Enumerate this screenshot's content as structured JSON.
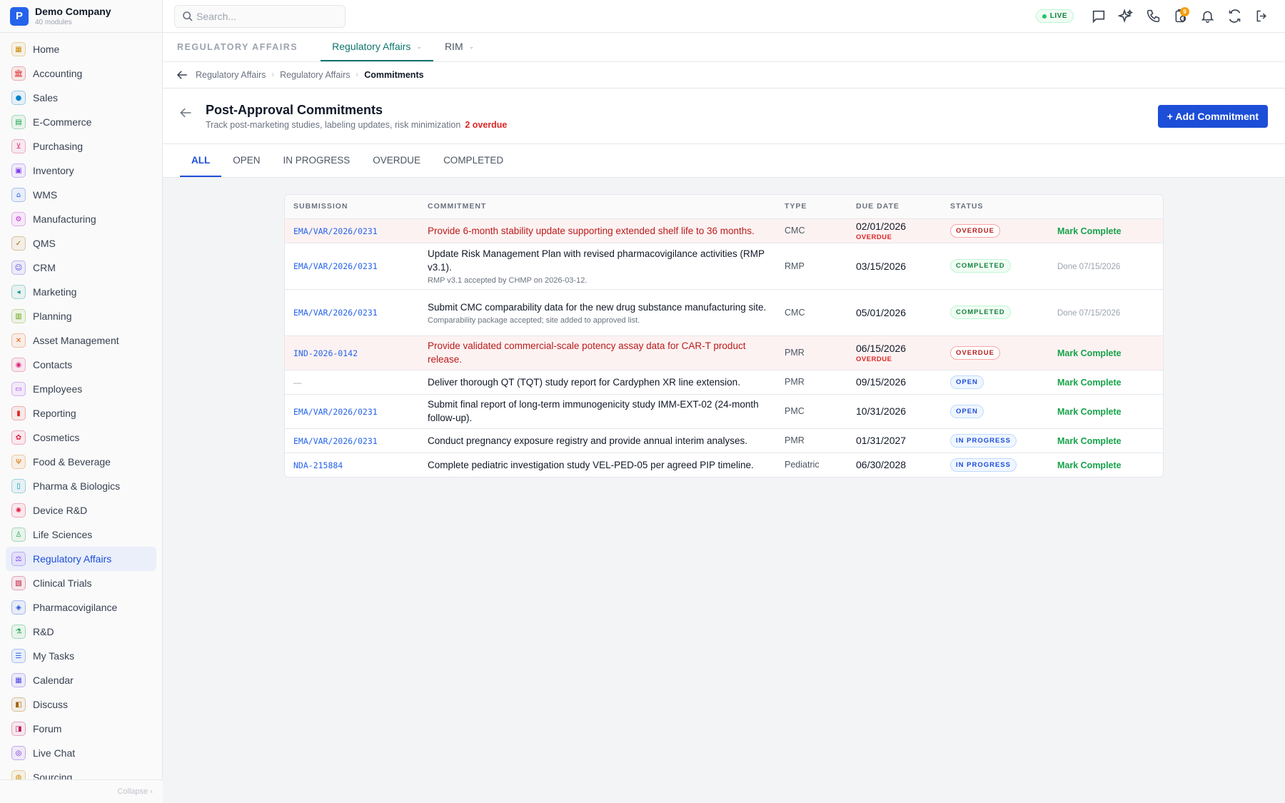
{
  "brand": {
    "logo_letter": "P",
    "name": "Demo Company",
    "sub": "40 modules"
  },
  "sidebar": {
    "items": [
      {
        "label": "Home",
        "icon": "grid-icon",
        "glyph": "▦",
        "color": "#ca8a04"
      },
      {
        "label": "Accounting",
        "icon": "bank-icon",
        "glyph": "🏛",
        "color": "#dc2626"
      },
      {
        "label": "Sales",
        "icon": "person-icon",
        "glyph": "●",
        "color": "#0284c7"
      },
      {
        "label": "E-Commerce",
        "icon": "store-icon",
        "glyph": "▤",
        "color": "#16a34a"
      },
      {
        "label": "Purchasing",
        "icon": "cart-icon",
        "glyph": "⊻",
        "color": "#db2777"
      },
      {
        "label": "Inventory",
        "icon": "box-icon",
        "glyph": "▣",
        "color": "#7c3aed"
      },
      {
        "label": "WMS",
        "icon": "warehouse-icon",
        "glyph": "⌂",
        "color": "#2563eb"
      },
      {
        "label": "Manufacturing",
        "icon": "factory-icon",
        "glyph": "⚙",
        "color": "#c026d3"
      },
      {
        "label": "QMS",
        "icon": "check-circle-icon",
        "glyph": "✓",
        "color": "#a16207"
      },
      {
        "label": "CRM",
        "icon": "people-icon",
        "glyph": "☺",
        "color": "#4f46e5"
      },
      {
        "label": "Marketing",
        "icon": "megaphone-icon",
        "glyph": "◂",
        "color": "#0d9488"
      },
      {
        "label": "Planning",
        "icon": "calendar-icon",
        "glyph": "▥",
        "color": "#65a30d"
      },
      {
        "label": "Asset Management",
        "icon": "tools-icon",
        "glyph": "✕",
        "color": "#ea580c"
      },
      {
        "label": "Contacts",
        "icon": "contact-icon",
        "glyph": "◉",
        "color": "#db2777"
      },
      {
        "label": "Employees",
        "icon": "briefcase-icon",
        "glyph": "▭",
        "color": "#9333ea"
      },
      {
        "label": "Reporting",
        "icon": "bar-chart-icon",
        "glyph": "▮",
        "color": "#dc2626"
      },
      {
        "label": "Cosmetics",
        "icon": "flower-icon",
        "glyph": "✿",
        "color": "#e11d48"
      },
      {
        "label": "Food & Beverage",
        "icon": "fork-knife-icon",
        "glyph": "Ψ",
        "color": "#d97706"
      },
      {
        "label": "Pharma & Biologics",
        "icon": "bottle-icon",
        "glyph": "▯",
        "color": "#0891b2"
      },
      {
        "label": "Device R&D",
        "icon": "gear-icon",
        "glyph": "✺",
        "color": "#e11d48"
      },
      {
        "label": "Life Sciences",
        "icon": "microscope-icon",
        "glyph": "♙",
        "color": "#16a34a"
      },
      {
        "label": "Regulatory Affairs",
        "icon": "gavel-icon",
        "glyph": "⚖",
        "color": "#7c3aed"
      },
      {
        "label": "Clinical Trials",
        "icon": "clipboard-icon",
        "glyph": "▧",
        "color": "#be123c"
      },
      {
        "label": "Pharmacovigilance",
        "icon": "shield-icon",
        "glyph": "◈",
        "color": "#1d4ed8"
      },
      {
        "label": "R&D",
        "icon": "flask-icon",
        "glyph": "⚗",
        "color": "#16a34a"
      },
      {
        "label": "My Tasks",
        "icon": "checklist-icon",
        "glyph": "☰",
        "color": "#2563eb"
      },
      {
        "label": "Calendar",
        "icon": "calendar-icon",
        "glyph": "▦",
        "color": "#4f46e5"
      },
      {
        "label": "Discuss",
        "icon": "chat-icon",
        "glyph": "◧",
        "color": "#a16207"
      },
      {
        "label": "Forum",
        "icon": "forum-icon",
        "glyph": "◨",
        "color": "#be185d"
      },
      {
        "label": "Live Chat",
        "icon": "headset-icon",
        "glyph": "◎",
        "color": "#6d28d9"
      },
      {
        "label": "Sourcing",
        "icon": "target-icon",
        "glyph": "◍",
        "color": "#ca8a04"
      }
    ],
    "active_index": 21,
    "collapse_label": "Collapse ‹"
  },
  "topbar": {
    "search_placeholder": "Search...",
    "live_label": "LIVE",
    "notif_count": "9"
  },
  "module_tabs": {
    "section_label": "REGULATORY AFFAIRS",
    "tabs": [
      "Regulatory Affairs",
      "RIM"
    ]
  },
  "breadcrumb": {
    "items": [
      "Regulatory Affairs",
      "Regulatory Affairs"
    ],
    "current": "Commitments"
  },
  "page": {
    "title": "Post-Approval Commitments",
    "subtitle": "Track post-marketing studies, labeling updates, risk minimization",
    "overdue_label": "2 overdue",
    "add_button": "+ Add Commitment"
  },
  "filter_tabs": [
    "ALL",
    "OPEN",
    "IN PROGRESS",
    "OVERDUE",
    "COMPLETED"
  ],
  "table": {
    "columns": [
      "SUBMISSION",
      "COMMITMENT",
      "TYPE",
      "DUE DATE",
      "STATUS",
      ""
    ],
    "rows": [
      {
        "submission": "EMA/VAR/2026/0231",
        "commitment": "Provide 6-month stability update supporting extended shelf life to 36 months.",
        "note": "",
        "type": "CMC",
        "due": "02/01/2026",
        "due_flag": "OVERDUE",
        "status": "OVERDUE",
        "status_kind": "overdue",
        "action": "Mark Complete",
        "action_kind": "link",
        "overdue": true
      },
      {
        "submission": "EMA/VAR/2026/0231",
        "commitment": "Update Risk Management Plan with revised pharmacovigilance activities (RMP v3.1).",
        "note": "RMP v3.1 accepted by CHMP on 2026-03-12.",
        "type": "RMP",
        "due": "03/15/2026",
        "due_flag": "",
        "status": "COMPLETED",
        "status_kind": "completed",
        "action": "Done 07/15/2026",
        "action_kind": "done",
        "overdue": false
      },
      {
        "submission": "EMA/VAR/2026/0231",
        "commitment": "Submit CMC comparability data for the new drug substance manufacturing site.",
        "note": "Comparability package accepted; site added to approved list.",
        "type": "CMC",
        "due": "05/01/2026",
        "due_flag": "",
        "status": "COMPLETED",
        "status_kind": "completed",
        "action": "Done 07/15/2026",
        "action_kind": "done",
        "overdue": false
      },
      {
        "submission": "IND-2026-0142",
        "commitment": "Provide validated commercial-scale potency assay data for CAR-T product release.",
        "note": "",
        "type": "PMR",
        "due": "06/15/2026",
        "due_flag": "OVERDUE",
        "status": "OVERDUE",
        "status_kind": "overdue",
        "action": "Mark Complete",
        "action_kind": "link",
        "overdue": true
      },
      {
        "submission": "—",
        "commitment": "Deliver thorough QT (TQT) study report for Cardyphen XR line extension.",
        "note": "",
        "type": "PMR",
        "due": "09/15/2026",
        "due_flag": "",
        "status": "OPEN",
        "status_kind": "open",
        "action": "Mark Complete",
        "action_kind": "link",
        "overdue": false
      },
      {
        "submission": "EMA/VAR/2026/0231",
        "commitment": "Submit final report of long-term immunogenicity study IMM-EXT-02 (24-month follow-up).",
        "note": "",
        "type": "PMC",
        "due": "10/31/2026",
        "due_flag": "",
        "status": "OPEN",
        "status_kind": "open",
        "action": "Mark Complete",
        "action_kind": "link",
        "overdue": false
      },
      {
        "submission": "EMA/VAR/2026/0231",
        "commitment": "Conduct pregnancy exposure registry and provide annual interim analyses.",
        "note": "",
        "type": "PMR",
        "due": "01/31/2027",
        "due_flag": "",
        "status": "IN PROGRESS",
        "status_kind": "inprogress",
        "action": "Mark Complete",
        "action_kind": "link",
        "overdue": false
      },
      {
        "submission": "NDA-215884",
        "commitment": "Complete pediatric investigation study VEL-PED-05 per agreed PIP timeline.",
        "note": "",
        "type": "Pediatric",
        "due": "06/30/2028",
        "due_flag": "",
        "status": "IN PROGRESS",
        "status_kind": "inprogress",
        "action": "Mark Complete",
        "action_kind": "link",
        "overdue": false
      }
    ]
  }
}
